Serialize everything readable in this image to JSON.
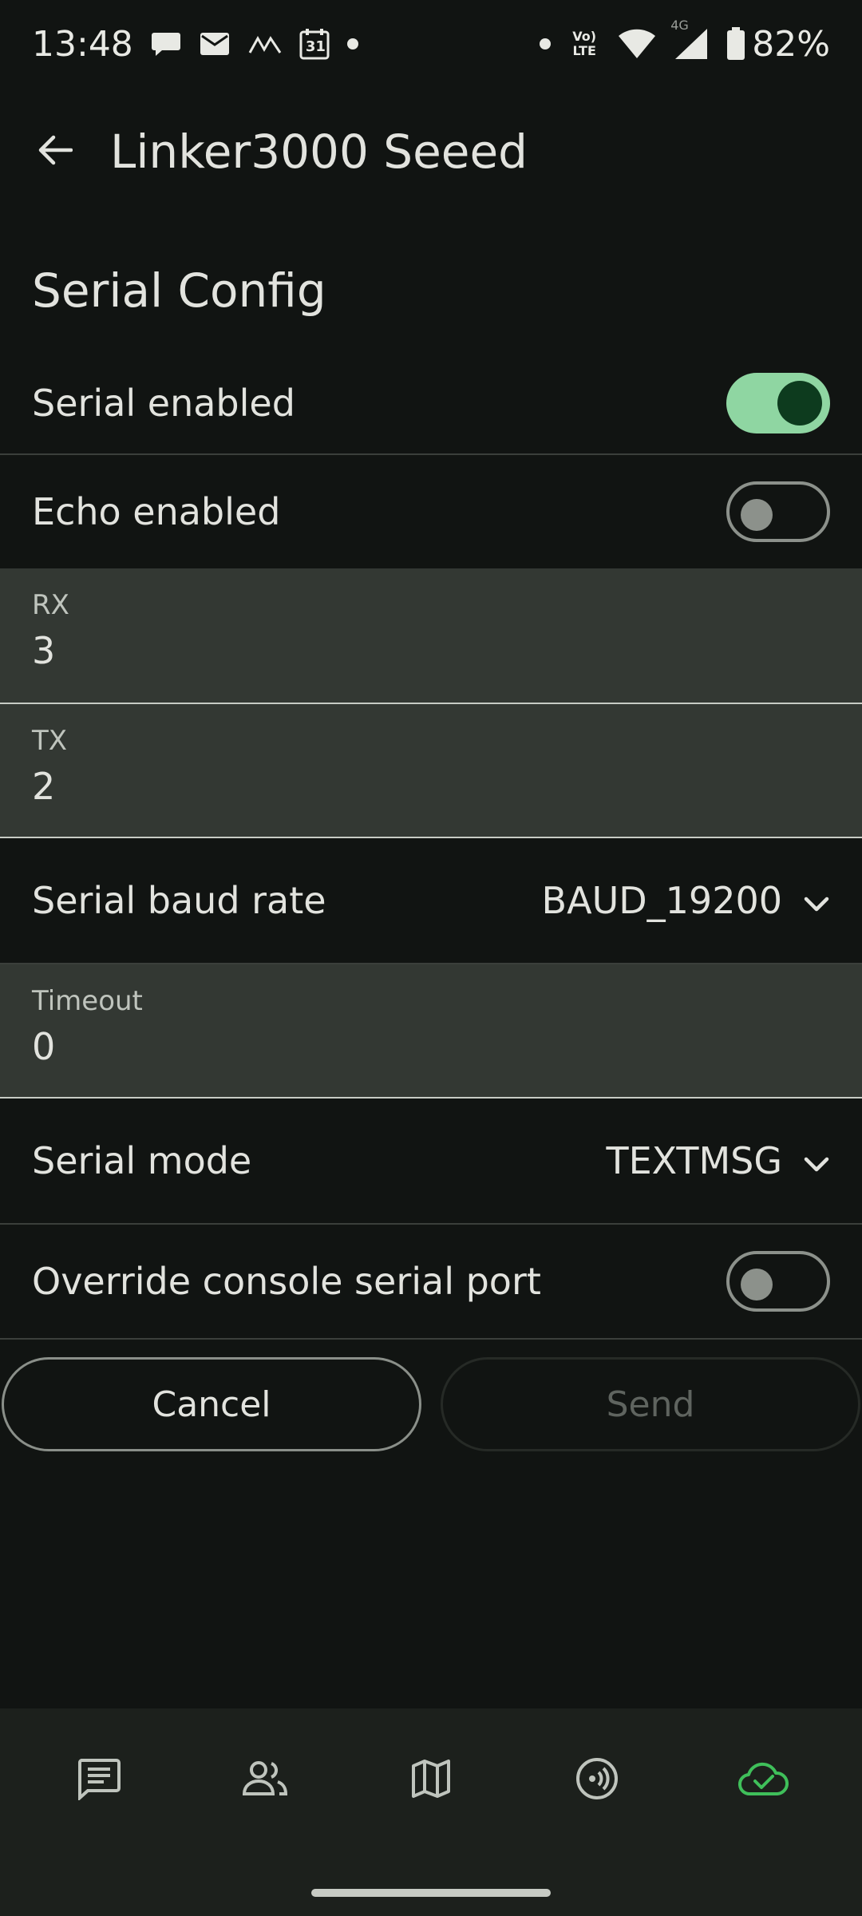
{
  "status_bar": {
    "time": "13:48",
    "battery": "82%",
    "network": "4G",
    "volte": "Vo) LTE",
    "calendar_day": "31",
    "left_icons": [
      "chat-bubble-icon",
      "mail-icon",
      "signal-wave-icon",
      "calendar-icon",
      "dot-icon"
    ],
    "right_icons": [
      "dot-icon",
      "volte-icon",
      "wifi-icon",
      "cell-signal-icon",
      "battery-icon"
    ]
  },
  "app_bar": {
    "title": "Linker3000 Seeed",
    "back_icon": "arrow-back-icon"
  },
  "section": {
    "title": "Serial Config"
  },
  "settings": {
    "serial_enabled": {
      "label": "Serial enabled",
      "on": true
    },
    "echo_enabled": {
      "label": "Echo enabled",
      "on": false
    },
    "rx": {
      "label": "RX",
      "value": "3"
    },
    "tx": {
      "label": "TX",
      "value": "2"
    },
    "baud_rate": {
      "label": "Serial baud rate",
      "value": "BAUD_19200"
    },
    "timeout": {
      "label": "Timeout",
      "value": "0"
    },
    "serial_mode": {
      "label": "Serial mode",
      "value": "TEXTMSG"
    },
    "override_console": {
      "label": "Override console serial port",
      "on": false
    }
  },
  "actions": {
    "cancel": "Cancel",
    "send": "Send"
  },
  "bottom_nav": {
    "items": [
      "messages-icon",
      "contacts-icon",
      "map-icon",
      "radio-icon",
      "cloud-connected-icon"
    ],
    "active_index": 4
  },
  "colors": {
    "background": "#111412",
    "accent_green": "#8fd6a2",
    "active_nav": "#3fbf5a",
    "field_background": "#333833"
  }
}
